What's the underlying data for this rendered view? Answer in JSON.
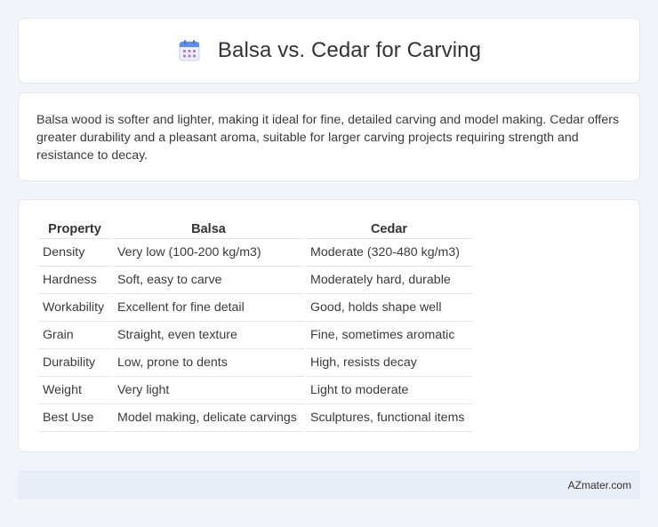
{
  "header": {
    "title": "Balsa vs. Cedar for Carving",
    "icon": "calendar-icon",
    "icon_colors": {
      "top": "#5b8def",
      "grid": "#b07be8",
      "body": "#eef0fb"
    }
  },
  "summary": {
    "text": "Balsa wood is softer and lighter, making it ideal for fine, detailed carving and model making. Cedar offers greater durability and a pleasant aroma, suitable for larger carving projects requiring strength and resistance to decay."
  },
  "table": {
    "headers": [
      "Property",
      "Balsa",
      "Cedar"
    ],
    "rows": [
      [
        "Density",
        "Very low (100-200 kg/m3)",
        "Moderate (320-480 kg/m3)"
      ],
      [
        "Hardness",
        "Soft, easy to carve",
        "Moderately hard, durable"
      ],
      [
        "Workability",
        "Excellent for fine detail",
        "Good, holds shape well"
      ],
      [
        "Grain",
        "Straight, even texture",
        "Fine, sometimes aromatic"
      ],
      [
        "Durability",
        "Low, prone to dents",
        "High, resists decay"
      ],
      [
        "Weight",
        "Very light",
        "Light to moderate"
      ],
      [
        "Best Use",
        "Model making, delicate carvings",
        "Sculptures, functional items"
      ]
    ]
  },
  "footer": {
    "text": "AZmater.com"
  }
}
